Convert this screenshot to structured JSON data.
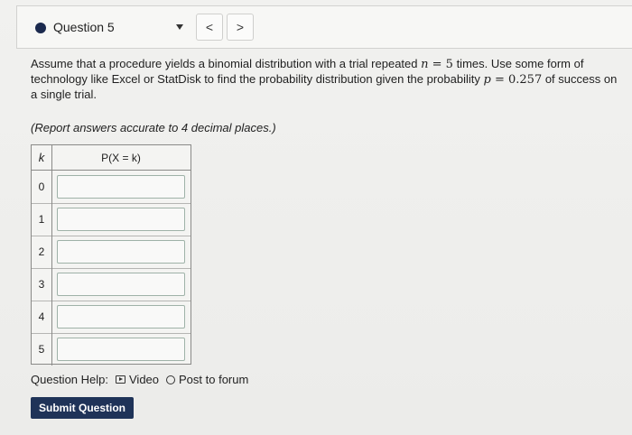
{
  "header": {
    "question_label": "Question 5",
    "prev_label": "<",
    "next_label": ">"
  },
  "question": {
    "part1": "Assume that a procedure yields a binomial distribution with a trial repeated ",
    "n_var": "n",
    "eq1": " = ",
    "n_value": "5",
    "part2": " times. Use some form of technology like Excel or StatDisk to find the probability distribution given the probability ",
    "p_var": "p",
    "eq2": " = ",
    "p_value": "0.257",
    "part3": " of success on a single trial.",
    "note": "(Report answers accurate to 4 decimal places.)"
  },
  "table": {
    "col_k": "k",
    "col_p": "P(X = k)",
    "rows": [
      {
        "k": "0",
        "value": ""
      },
      {
        "k": "1",
        "value": ""
      },
      {
        "k": "2",
        "value": ""
      },
      {
        "k": "3",
        "value": ""
      },
      {
        "k": "4",
        "value": ""
      },
      {
        "k": "5",
        "value": ""
      }
    ]
  },
  "help": {
    "label": "Question Help:",
    "video": "Video",
    "forum": "Post to forum",
    "video_icon": "play-video-icon",
    "forum_icon": "speech-bubble-icon"
  },
  "submit_label": "Submit Question",
  "colors": {
    "accent": "#1f3358",
    "status_dot": "#1b2a4e"
  }
}
